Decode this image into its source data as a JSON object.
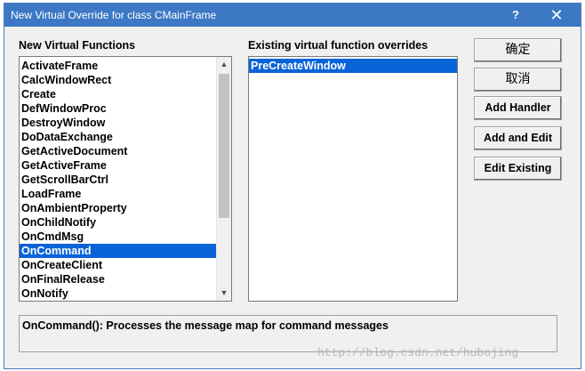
{
  "window": {
    "title": "New Virtual Override for class CMainFrame",
    "help_glyph": "?",
    "close_glyph": "✕"
  },
  "left_panel": {
    "label": "New Virtual Functions",
    "items": [
      "ActivateFrame",
      "CalcWindowRect",
      "Create",
      "DefWindowProc",
      "DestroyWindow",
      "DoDataExchange",
      "GetActiveDocument",
      "GetActiveFrame",
      "GetScrollBarCtrl",
      "LoadFrame",
      "OnAmbientProperty",
      "OnChildNotify",
      "OnCmdMsg",
      "OnCommand",
      "OnCreateClient",
      "OnFinalRelease",
      "OnNotify"
    ],
    "selected": "OnCommand"
  },
  "right_panel": {
    "label": "Existing virtual function overrides",
    "items": [
      "PreCreateWindow"
    ],
    "selected": "PreCreateWindow"
  },
  "buttons": {
    "ok": "确定",
    "cancel": "取消",
    "add_handler": "Add Handler",
    "add_and_edit": "Add and Edit",
    "edit_existing": "Edit Existing"
  },
  "description": "OnCommand():  Processes the message map for command messages",
  "watermark": "http://blog.csdn.net/hubojing",
  "colors": {
    "titlebar": "#3c78c4",
    "selection": "#0a64d8"
  }
}
